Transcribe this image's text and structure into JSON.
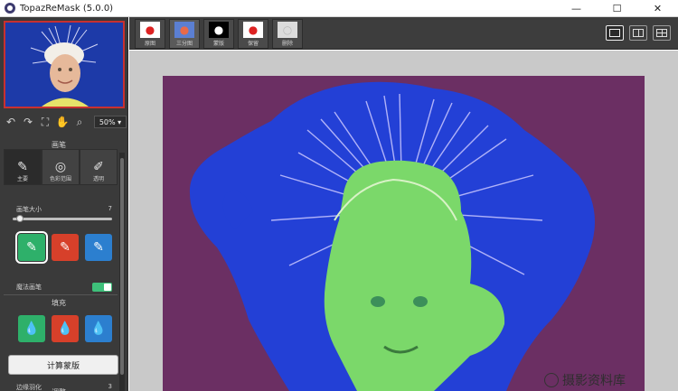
{
  "window": {
    "title": "TopazReMask (5.0.0)",
    "minimize_glyph": "—",
    "maximize_glyph": "☐",
    "close_glyph": "✕"
  },
  "toolbar_left": {
    "zoom": "50%",
    "icons": [
      "undo-icon",
      "redo-icon",
      "fit-icon",
      "hand-icon",
      "magnifier-icon"
    ]
  },
  "brush": {
    "section_title": "画笔",
    "tabs": [
      {
        "label": "主要",
        "icon": "brush-icon",
        "active": true
      },
      {
        "label": "色彩范围",
        "icon": "color-range-icon",
        "active": false
      },
      {
        "label": "透明",
        "icon": "transparent-brush-icon",
        "active": false
      }
    ],
    "size_label": "画笔大小",
    "size_value": "7",
    "size_fraction": 0.04,
    "magic_label": "魔法画笔",
    "magic_on": true
  },
  "fill": {
    "section_title": "填充"
  },
  "calc_button": "计算蒙版",
  "adjust": {
    "section_title": "调整",
    "edge_label": "边缘羽化",
    "edge_value": "3"
  },
  "view_tabs": [
    {
      "label": "原图",
      "icon": "apple-original-icon",
      "active": false
    },
    {
      "label": "三分图",
      "icon": "apple-trimap-icon",
      "active": true
    },
    {
      "label": "蒙版",
      "icon": "apple-mask-icon",
      "active": false
    },
    {
      "label": "保留",
      "icon": "apple-keep-icon",
      "active": false
    },
    {
      "label": "删除",
      "icon": "apple-delete-icon",
      "active": false
    }
  ],
  "layout_buttons": [
    "single-view-icon",
    "split-view-icon",
    "quad-view-icon"
  ],
  "watermark": "摄影资料库",
  "colors": {
    "keep": "#2eb06a",
    "drop": "#d7402a",
    "compute": "#2c7fcf",
    "canvas_bg": "#6b2f63",
    "trimap_blue": "#2340d6"
  }
}
